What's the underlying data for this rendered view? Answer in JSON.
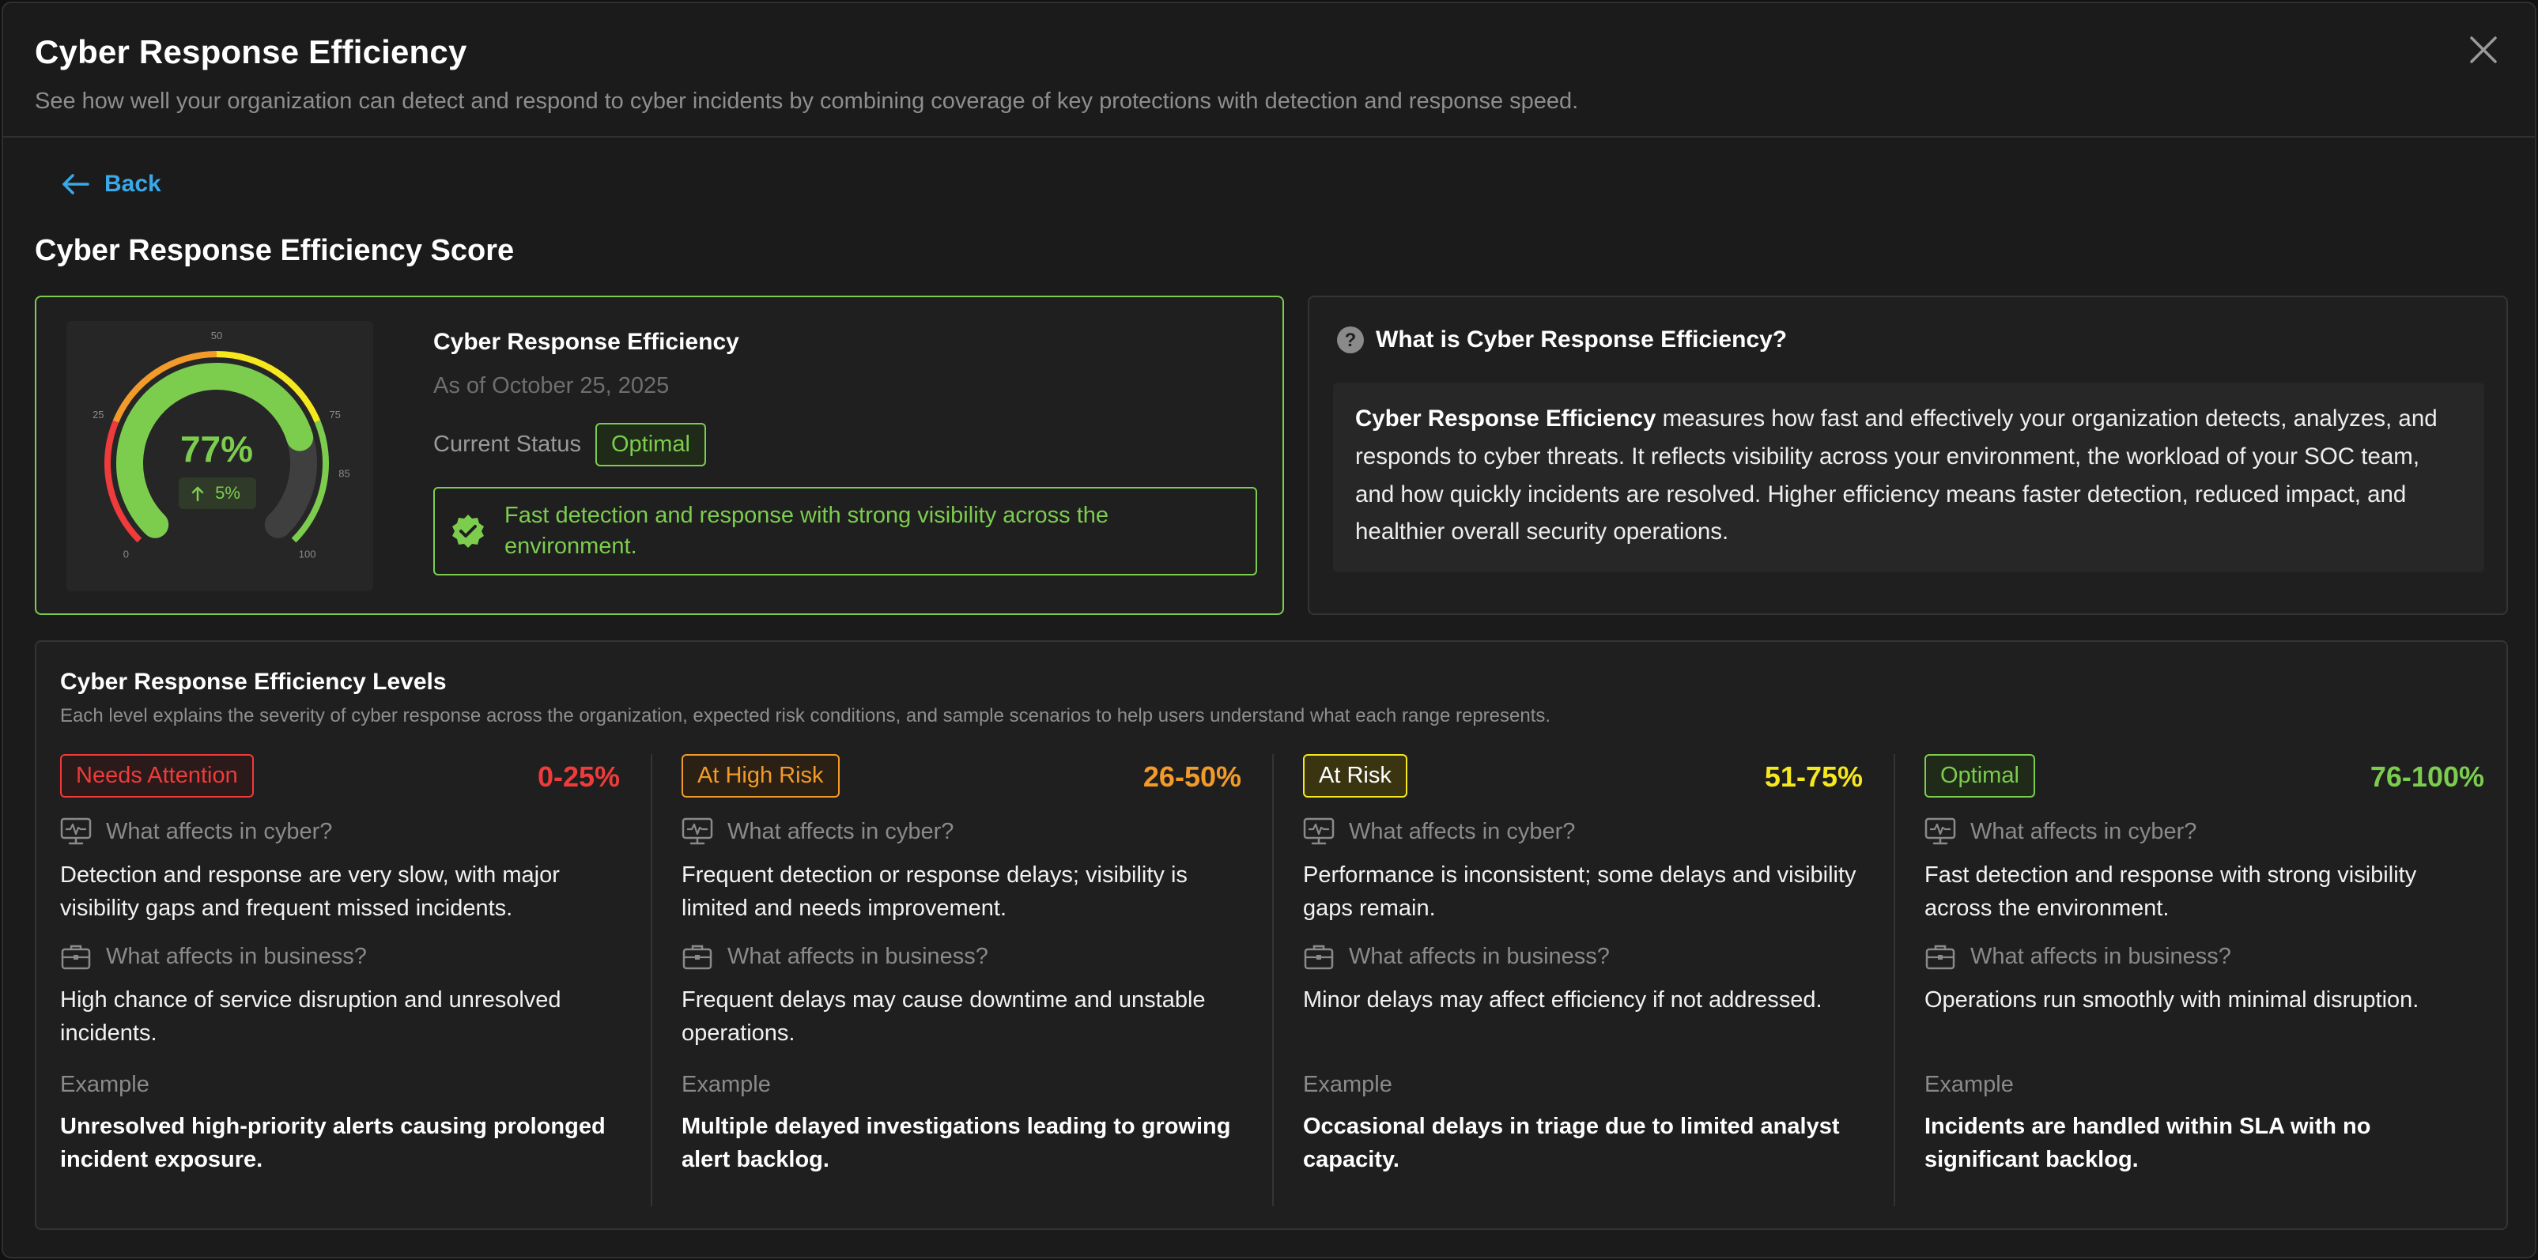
{
  "header": {
    "title": "Cyber Response Efficiency",
    "subtitle": "See how well your organization can detect and respond to cyber incidents by combining coverage of key protections with detection and response speed."
  },
  "nav": {
    "back_label": "Back"
  },
  "section": {
    "title": "Cyber Response Efficiency Score"
  },
  "score": {
    "name": "Cyber Response Efficiency",
    "as_of": "As of October 25, 2025",
    "status_label": "Current Status",
    "status": "Optimal",
    "status_description": "Fast detection and response with strong visibility across the environment.",
    "gauge": {
      "value": 77,
      "value_text": "77%",
      "change_text": "5%",
      "min": 0,
      "max": 100,
      "tick_labels": [
        "0",
        "25",
        "50",
        "75",
        "85",
        "100"
      ]
    }
  },
  "info": {
    "title": "What is Cyber Response Efficiency?",
    "lead": "Cyber Response Efficiency",
    "body": " measures how fast and effectively your organization detects, analyzes, and responds to cyber threats. It reflects visibility across your environment, the workload of your SOC team, and how quickly incidents are resolved. Higher efficiency means faster detection, reduced impact, and healthier overall security operations."
  },
  "levels": {
    "title": "Cyber Response Efficiency Levels",
    "subtitle": "Each level explains the severity of cyber response across the organization, expected risk conditions, and sample scenarios to help users understand what each range represents.",
    "cyber_question": "What affects in cyber?",
    "business_question": "What affects in business?",
    "example_label": "Example",
    "items": [
      {
        "name": "Needs Attention",
        "range": "0-25%",
        "color": "#ef3b3b",
        "cyber": "Detection and response are very slow, with major visibility gaps and frequent missed incidents.",
        "business": "High chance of service disruption and unresolved incidents.",
        "example": "Unresolved high-priority alerts causing prolonged incident exposure."
      },
      {
        "name": "At High Risk",
        "range": "26-50%",
        "color": "#f39b2a",
        "cyber": "Frequent detection or response delays; visibility is limited and needs improvement.",
        "business": "Frequent delays may cause downtime and unstable operations.",
        "example": "Multiple delayed investigations leading to growing alert backlog."
      },
      {
        "name": "At Risk",
        "range": "51-75%",
        "color": "#f5e81e",
        "cyber": "Performance is inconsistent; some delays and visibility gaps remain.",
        "business": "Minor delays may affect efficiency if not addressed.",
        "example": "Occasional delays in triage due to limited analyst capacity."
      },
      {
        "name": "Optimal",
        "range": "76-100%",
        "color": "#7ccd4e",
        "cyber": "Fast detection and response with strong visibility across the environment.",
        "business": "Operations run smoothly with minimal disruption.",
        "example": "Incidents are handled within SLA with no significant backlog."
      }
    ]
  }
}
